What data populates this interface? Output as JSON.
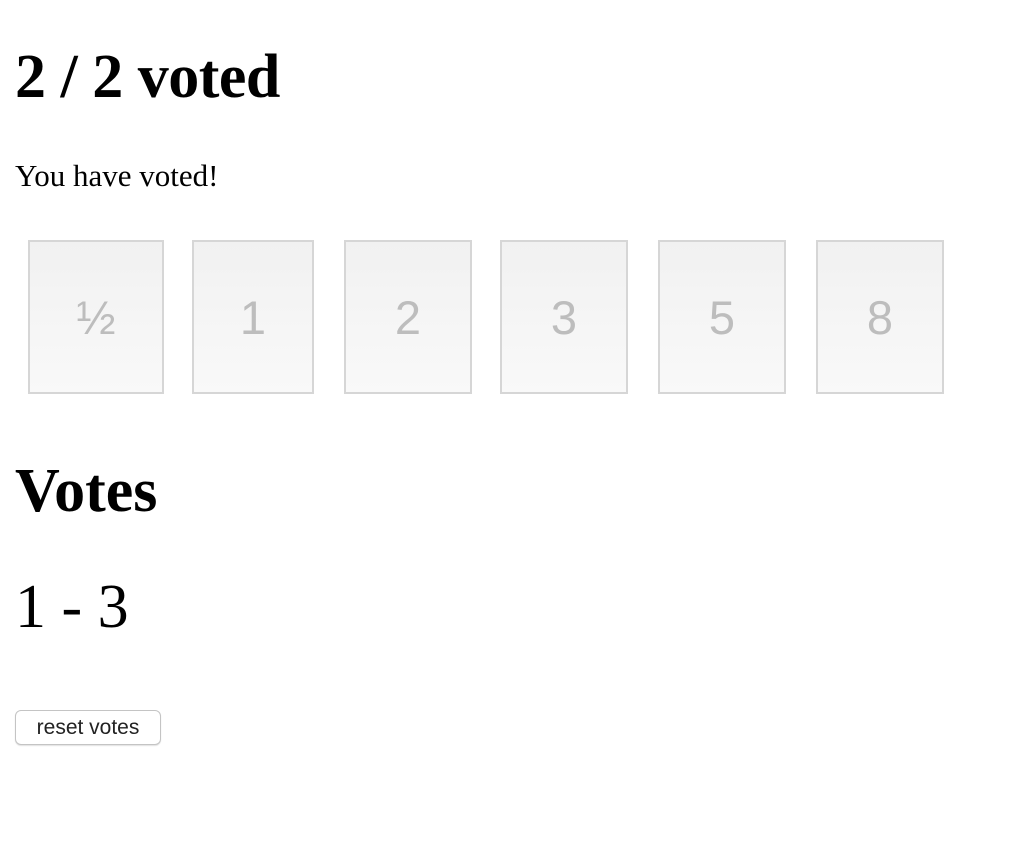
{
  "header": {
    "vote_count": "2 / 2 voted",
    "status": "You have voted!"
  },
  "cards": [
    {
      "label": "½"
    },
    {
      "label": "1"
    },
    {
      "label": "2"
    },
    {
      "label": "3"
    },
    {
      "label": "5"
    },
    {
      "label": "8"
    }
  ],
  "results": {
    "heading": "Votes",
    "range": "1 - 3"
  },
  "actions": {
    "reset_label": "reset votes"
  },
  "colors": {
    "card_border": "#d6d6d6",
    "card_text": "#bdbdbd",
    "card_background": "#f5f5f5"
  }
}
